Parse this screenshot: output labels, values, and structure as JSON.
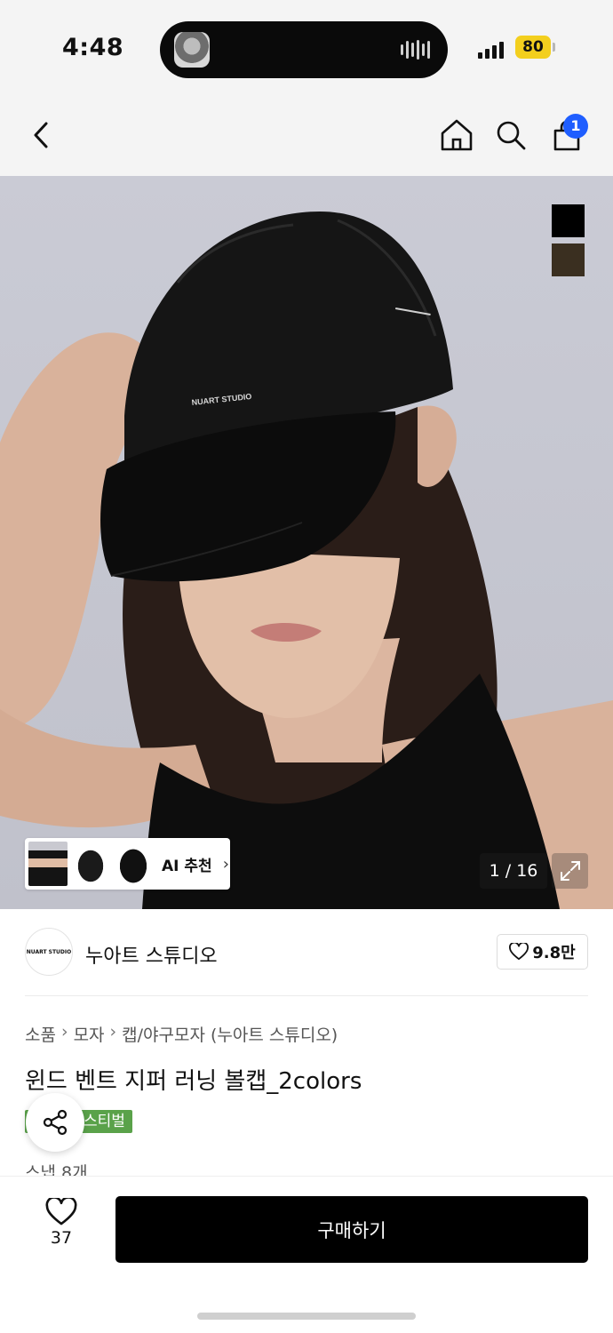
{
  "status_bar": {
    "time": "4:48",
    "battery": "80",
    "battery_color": "#f3cf1e"
  },
  "top_nav": {
    "back_icon": "chevron-left-icon",
    "home_icon": "home-icon",
    "search_icon": "search-icon",
    "cart_icon": "shopping-bag-icon",
    "cart_badge": "1",
    "badge_color": "#1f5eff"
  },
  "gallery": {
    "image_text": "NUART STUDIO",
    "color_swatches": [
      "#000000",
      "#3a2f20"
    ],
    "ai_recommend_label": "AI 추천",
    "ai_chevron": "›",
    "counter": "1 / 16",
    "expand_icon": "expand-icon"
  },
  "brand": {
    "logo_text": "NUART STUDIO",
    "name": "누아트 스튜디오",
    "likes": "9.8만"
  },
  "product": {
    "breadcrumb": [
      "소품",
      "모자",
      "캡/야구모자 (누아트 스튜디오)"
    ],
    "breadcrumb_sep": "›",
    "title": "윈드 벤트 지퍼 러닝 볼캡_2colors",
    "tag": "스티벌",
    "tag_color": "#5aa24a",
    "snap_count": "스냅 8개"
  },
  "bottom_bar": {
    "wish_count": "37",
    "buy_label": "구매하기"
  }
}
